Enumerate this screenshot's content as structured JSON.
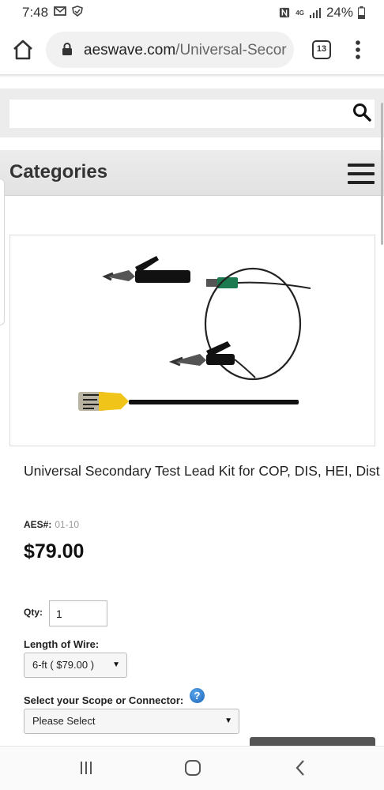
{
  "status_bar": {
    "time": "7:48",
    "battery": "24%",
    "network": "4G",
    "icons": [
      "gmail-icon",
      "shield-icon",
      "nfc-icon",
      "signal-icon",
      "battery-icon"
    ]
  },
  "browser": {
    "url_domain": "aeswave.com",
    "url_path": "/Universal-Secor",
    "tab_count": "13",
    "icons": [
      "home-icon",
      "lock-icon",
      "more-vert-icon"
    ]
  },
  "search": {
    "value": "",
    "placeholder": ""
  },
  "categories": {
    "title": "Categories"
  },
  "product": {
    "image_icon": "test-lead-kit-photo",
    "title": "Universal Secondary Test Lead Kit for COP, DIS, HEI, Dist",
    "aes_label": "AES#:",
    "aes_value": "01-10",
    "price": "$79.00",
    "qty_label": "Qty:",
    "qty_value": "1",
    "wire_label": "Length of Wire:",
    "wire_selected": "6-ft ( $79.00 )",
    "scope_label": "Select your Scope or Connector:",
    "scope_selected": "Please Select",
    "help_glyph": "?"
  },
  "nav": {
    "icons": [
      "recent-apps-icon",
      "home-circle-icon",
      "back-icon"
    ]
  },
  "colors": {
    "help_blue": "#1a63b8",
    "band_gray": "#ececec",
    "probe_yellow": "#f0c419"
  }
}
